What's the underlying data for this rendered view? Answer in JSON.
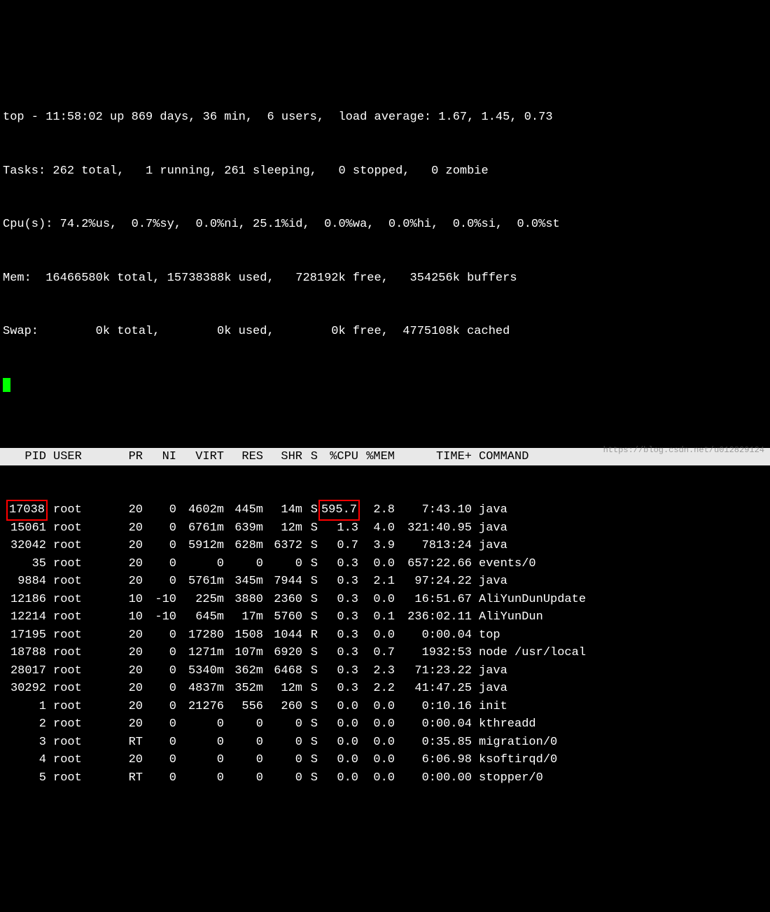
{
  "summary": {
    "line1": "top - 11:58:02 up 869 days, 36 min,  6 users,  load average: 1.67, 1.45, 0.73",
    "line2": "Tasks: 262 total,   1 running, 261 sleeping,   0 stopped,   0 zombie",
    "line3": "Cpu(s): 74.2%us,  0.7%sy,  0.0%ni, 25.1%id,  0.0%wa,  0.0%hi,  0.0%si,  0.0%st",
    "line4": "Mem:  16466580k total, 15738388k used,   728192k free,   354256k buffers",
    "line5": "Swap:        0k total,        0k used,        0k free,  4775108k cached"
  },
  "headers": {
    "pid": "PID",
    "user": "USER",
    "pr": "PR",
    "ni": "NI",
    "virt": "VIRT",
    "res": "RES",
    "shr": "SHR",
    "s": "S",
    "cpu": "%CPU",
    "mem": "%MEM",
    "time": "TIME+",
    "command": "COMMAND"
  },
  "highlights": {
    "row0_pid": true,
    "row0_cpu": true
  },
  "processes": [
    {
      "pid": "17038",
      "user": "root",
      "pr": "20",
      "ni": "0",
      "virt": "4602m",
      "res": "445m",
      "shr": "14m",
      "s": "S",
      "cpu": "595.7",
      "mem": "2.8",
      "time": "7:43.10",
      "cmd": "java"
    },
    {
      "pid": "15061",
      "user": "root",
      "pr": "20",
      "ni": "0",
      "virt": "6761m",
      "res": "639m",
      "shr": "12m",
      "s": "S",
      "cpu": "1.3",
      "mem": "4.0",
      "time": "321:40.95",
      "cmd": "java"
    },
    {
      "pid": "32042",
      "user": "root",
      "pr": "20",
      "ni": "0",
      "virt": "5912m",
      "res": "628m",
      "shr": "6372",
      "s": "S",
      "cpu": "0.7",
      "mem": "3.9",
      "time": "7813:24",
      "cmd": "java"
    },
    {
      "pid": "35",
      "user": "root",
      "pr": "20",
      "ni": "0",
      "virt": "0",
      "res": "0",
      "shr": "0",
      "s": "S",
      "cpu": "0.3",
      "mem": "0.0",
      "time": "657:22.66",
      "cmd": "events/0"
    },
    {
      "pid": "9884",
      "user": "root",
      "pr": "20",
      "ni": "0",
      "virt": "5761m",
      "res": "345m",
      "shr": "7944",
      "s": "S",
      "cpu": "0.3",
      "mem": "2.1",
      "time": "97:24.22",
      "cmd": "java"
    },
    {
      "pid": "12186",
      "user": "root",
      "pr": "10",
      "ni": "-10",
      "virt": "225m",
      "res": "3880",
      "shr": "2360",
      "s": "S",
      "cpu": "0.3",
      "mem": "0.0",
      "time": "16:51.67",
      "cmd": "AliYunDunUpdate"
    },
    {
      "pid": "12214",
      "user": "root",
      "pr": "10",
      "ni": "-10",
      "virt": "645m",
      "res": "17m",
      "shr": "5760",
      "s": "S",
      "cpu": "0.3",
      "mem": "0.1",
      "time": "236:02.11",
      "cmd": "AliYunDun"
    },
    {
      "pid": "17195",
      "user": "root",
      "pr": "20",
      "ni": "0",
      "virt": "17280",
      "res": "1508",
      "shr": "1044",
      "s": "R",
      "cpu": "0.3",
      "mem": "0.0",
      "time": "0:00.04",
      "cmd": "top"
    },
    {
      "pid": "18788",
      "user": "root",
      "pr": "20",
      "ni": "0",
      "virt": "1271m",
      "res": "107m",
      "shr": "6920",
      "s": "S",
      "cpu": "0.3",
      "mem": "0.7",
      "time": "1932:53",
      "cmd": "node /usr/local"
    },
    {
      "pid": "28017",
      "user": "root",
      "pr": "20",
      "ni": "0",
      "virt": "5340m",
      "res": "362m",
      "shr": "6468",
      "s": "S",
      "cpu": "0.3",
      "mem": "2.3",
      "time": "71:23.22",
      "cmd": "java"
    },
    {
      "pid": "30292",
      "user": "root",
      "pr": "20",
      "ni": "0",
      "virt": "4837m",
      "res": "352m",
      "shr": "12m",
      "s": "S",
      "cpu": "0.3",
      "mem": "2.2",
      "time": "41:47.25",
      "cmd": "java"
    },
    {
      "pid": "1",
      "user": "root",
      "pr": "20",
      "ni": "0",
      "virt": "21276",
      "res": "556",
      "shr": "260",
      "s": "S",
      "cpu": "0.0",
      "mem": "0.0",
      "time": "0:10.16",
      "cmd": "init"
    },
    {
      "pid": "2",
      "user": "root",
      "pr": "20",
      "ni": "0",
      "virt": "0",
      "res": "0",
      "shr": "0",
      "s": "S",
      "cpu": "0.0",
      "mem": "0.0",
      "time": "0:00.04",
      "cmd": "kthreadd"
    },
    {
      "pid": "3",
      "user": "root",
      "pr": "RT",
      "ni": "0",
      "virt": "0",
      "res": "0",
      "shr": "0",
      "s": "S",
      "cpu": "0.0",
      "mem": "0.0",
      "time": "0:35.85",
      "cmd": "migration/0"
    },
    {
      "pid": "4",
      "user": "root",
      "pr": "20",
      "ni": "0",
      "virt": "0",
      "res": "0",
      "shr": "0",
      "s": "S",
      "cpu": "0.0",
      "mem": "0.0",
      "time": "6:06.98",
      "cmd": "ksoftirqd/0"
    },
    {
      "pid": "5",
      "user": "root",
      "pr": "RT",
      "ni": "0",
      "virt": "0",
      "res": "0",
      "shr": "0",
      "s": "S",
      "cpu": "0.0",
      "mem": "0.0",
      "time": "0:00.00",
      "cmd": "stopper/0"
    }
  ],
  "watermark": "https://blog.csdn.net/u012829124"
}
